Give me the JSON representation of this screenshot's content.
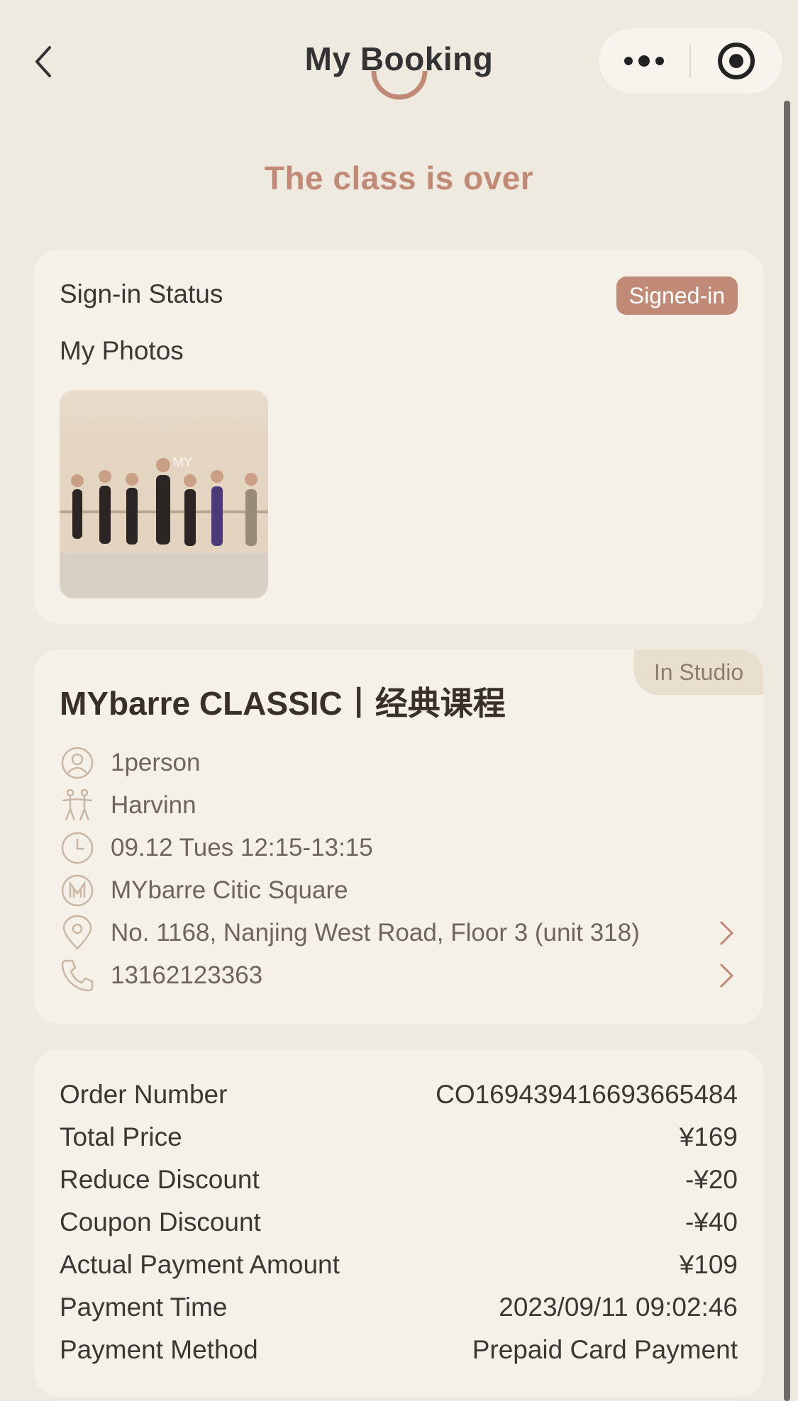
{
  "nav": {
    "title": "My Booking"
  },
  "status": {
    "text": "The class is over"
  },
  "signin": {
    "label": "Sign-in Status",
    "badge": "Signed-in",
    "photos_label": "My Photos"
  },
  "class_info": {
    "tag": "In Studio",
    "title": "MYbarre CLASSIC丨经典课程",
    "rows": [
      {
        "icon": "person-icon",
        "text": "1person",
        "link": false
      },
      {
        "icon": "dancers-icon",
        "text": "Harvinn",
        "link": false
      },
      {
        "icon": "clock-icon",
        "text": "09.12 Tues 12:15-13:15",
        "link": false
      },
      {
        "icon": "mybarre-logo-icon",
        "text": "MYbarre Citic Square",
        "link": false
      },
      {
        "icon": "location-pin-icon",
        "text": "No. 1168, Nanjing West Road, Floor 3 (unit 318)",
        "link": true
      },
      {
        "icon": "phone-icon",
        "text": "13162123363",
        "link": true
      }
    ]
  },
  "order": {
    "rows": [
      {
        "label": "Order Number",
        "value": "CO1694394166936654​84"
      },
      {
        "label": "Total Price",
        "value": "¥169"
      },
      {
        "label": "Reduce Discount",
        "value": "-¥20"
      },
      {
        "label": "Coupon Discount",
        "value": "-¥40"
      },
      {
        "label": "Actual Payment Amount",
        "value": "¥109"
      },
      {
        "label": "Payment Time",
        "value": "2023/09/11 09:02:46"
      },
      {
        "label": "Payment Method",
        "value": "Prepaid Card Payment"
      }
    ]
  },
  "colors": {
    "accent": "#c08a76",
    "background": "#efeae0",
    "card": "#f5f0e8",
    "icon": "#c9b7a3"
  }
}
